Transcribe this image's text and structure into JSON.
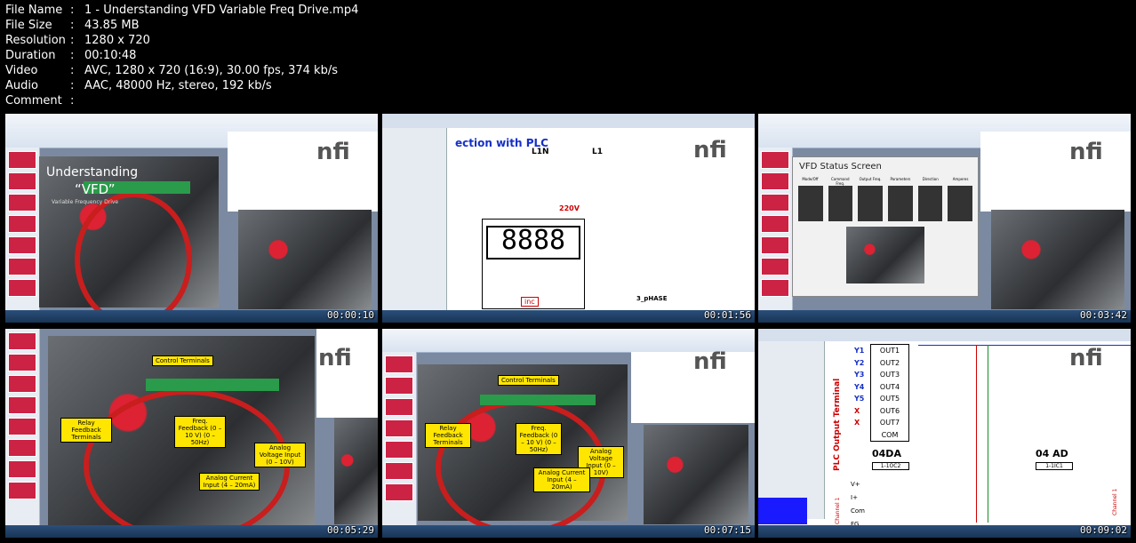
{
  "file_info": [
    {
      "key": "File Name",
      "value": "1 - Understanding VFD Variable Freq Drive.mp4"
    },
    {
      "key": "File Size",
      "value": "43.85 MB"
    },
    {
      "key": "Resolution",
      "value": "1280 x 720"
    },
    {
      "key": "Duration",
      "value": "00:10:48"
    },
    {
      "key": "Video",
      "value": "AVC, 1280 x 720 (16:9), 30.00 fps, 374 kb/s"
    },
    {
      "key": "Audio",
      "value": "AAC, 48000 Hz, stereo, 192 kb/s"
    },
    {
      "key": "Comment",
      "value": ""
    }
  ],
  "thumbnails": [
    {
      "timestamp": "00:00:10",
      "title": "Understanding",
      "title2": "“VFD”",
      "subtitle": "Variable Frequency Drive",
      "logo": "nfi"
    },
    {
      "timestamp": "00:01:56",
      "heading": "ection with PLC",
      "labels": [
        "L1N",
        "L1",
        "220V",
        "inc",
        "3_pHASE"
      ],
      "display": "8888"
    },
    {
      "timestamp": "00:03:42",
      "heading": "VFD Status Screen",
      "columns": [
        "Mode/Off",
        "Command Freq.",
        "Output Freq.",
        "Parameters",
        "Direction",
        "Amperes"
      ]
    },
    {
      "timestamp": "00:05:29",
      "callouts": [
        "Control Terminals",
        "Relay Feedback Terminals",
        "Freq. Feedback (0 – 10 V) (0 – 50Hz)",
        "Analog Voltage Input (0 – 10V)",
        "Analog Current Input (4 – 20mA)"
      ]
    },
    {
      "timestamp": "00:07:15",
      "callouts": [
        "Control Terminals",
        "Relay Feedback Terminals",
        "Freq. Feedback (0 – 10 V) (0 – 50Hz)",
        "Analog Voltage Input (0 – 10V)",
        "Analog Current Input (4 – 20mA)"
      ]
    },
    {
      "timestamp": "00:09:02",
      "side_label": "PLC Output Terminal",
      "outputs": [
        "Y1",
        "Y2",
        "Y3",
        "Y4",
        "Y5",
        "X",
        "X"
      ],
      "outs": [
        "OUT1",
        "OUT2",
        "OUT3",
        "OUT4",
        "OUT5",
        "OUT6",
        "OUT7",
        "COM"
      ],
      "modules": [
        "04DA",
        "04 AD"
      ],
      "module_ids": [
        "1-1OC2",
        "1-1IC1"
      ],
      "pins": [
        "V+",
        "I+",
        "Com",
        "FG"
      ],
      "channel": "Channel 1"
    }
  ],
  "colors": {
    "accent_red": "#c81e1e",
    "terminal_green": "#2a9b4a",
    "callout_yellow": "#ffe600",
    "blue_plc": "#1530c8"
  }
}
